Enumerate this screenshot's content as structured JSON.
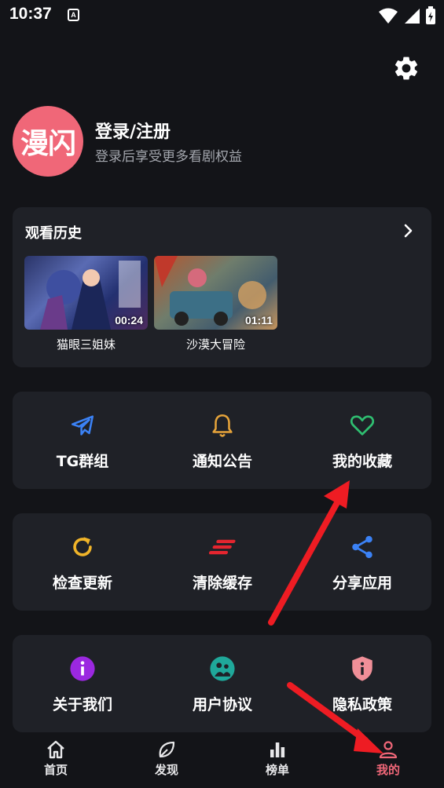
{
  "status_bar": {
    "time": "10:37",
    "a_badge": "A"
  },
  "profile": {
    "avatar_text": "漫闪",
    "login_title": "登录/注册",
    "login_subtitle": "登录后享受更多看剧权益"
  },
  "history": {
    "title": "观看历史",
    "items": [
      {
        "title": "猫眼三姐妹",
        "duration": "00:24"
      },
      {
        "title": "沙漠大冒险",
        "duration": "01:11"
      }
    ]
  },
  "grid": {
    "row1": [
      {
        "label": "TG群组",
        "icon": "telegram-icon",
        "color": "#3b82f6"
      },
      {
        "label": "通知公告",
        "icon": "bell-icon",
        "color": "#e5a33a"
      },
      {
        "label": "我的收藏",
        "icon": "heart-icon",
        "color": "#2fbf71"
      }
    ],
    "row2": [
      {
        "label": "检查更新",
        "icon": "refresh-icon",
        "color": "#f0b429"
      },
      {
        "label": "清除缓存",
        "icon": "clear-icon",
        "color": "#e5252f"
      },
      {
        "label": "分享应用",
        "icon": "share-icon",
        "color": "#3b82f6"
      }
    ],
    "row3": [
      {
        "label": "关于我们",
        "icon": "info-icon",
        "color": "#9b28e0"
      },
      {
        "label": "用户协议",
        "icon": "agreement-icon",
        "color": "#1fa89a"
      },
      {
        "label": "隐私政策",
        "icon": "shield-icon",
        "color": "#f08f98"
      }
    ]
  },
  "bottom_nav": {
    "items": [
      {
        "label": "首页",
        "icon": "home-icon"
      },
      {
        "label": "发现",
        "icon": "leaf-icon"
      },
      {
        "label": "榜单",
        "icon": "chart-icon"
      },
      {
        "label": "我的",
        "icon": "user-icon",
        "active": true
      }
    ],
    "active_color": "#f06778"
  }
}
